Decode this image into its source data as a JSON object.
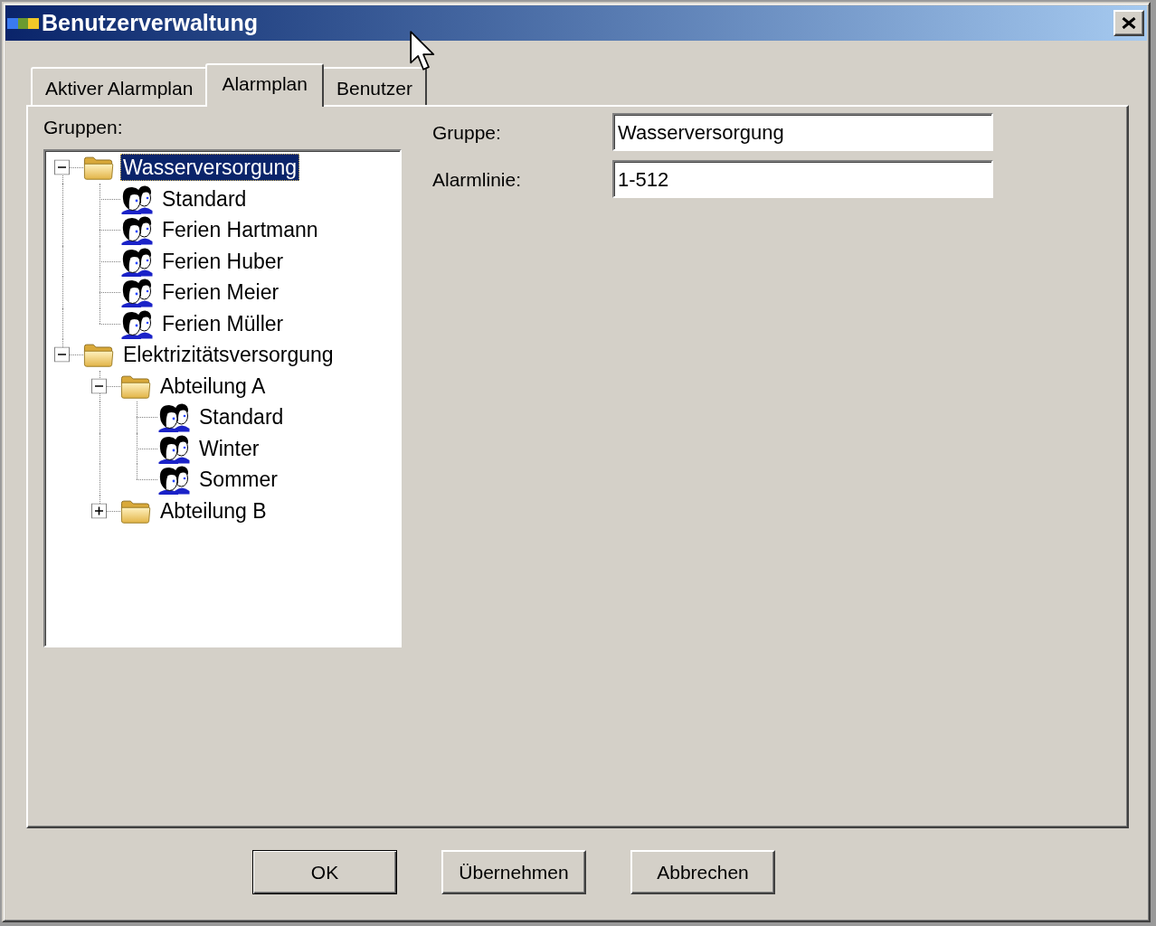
{
  "window": {
    "title": "Benutzerverwaltung"
  },
  "tabs": [
    {
      "label": "Aktiver Alarmplan",
      "selected": false
    },
    {
      "label": "Alarmplan",
      "selected": true
    },
    {
      "label": "Benutzer",
      "selected": false
    }
  ],
  "groups": {
    "label": "Gruppen:",
    "tree": [
      {
        "kind": "folder",
        "label": "Wasserversorgung",
        "expanded": true,
        "selected": true,
        "children": [
          {
            "kind": "user_group",
            "label": "Standard",
            "selected": false
          },
          {
            "kind": "user_group",
            "label": "Ferien Hartmann",
            "selected": false
          },
          {
            "kind": "user_group",
            "label": "Ferien Huber",
            "selected": false
          },
          {
            "kind": "user_group",
            "label": "Ferien Meier",
            "selected": false
          },
          {
            "kind": "user_group",
            "label": "Ferien Müller",
            "selected": false
          }
        ]
      },
      {
        "kind": "folder",
        "label": "Elektrizitätsversorgung",
        "expanded": true,
        "selected": false,
        "children": [
          {
            "kind": "folder",
            "label": "Abteilung A",
            "expanded": true,
            "selected": false,
            "children": [
              {
                "kind": "user_group",
                "label": "Standard",
                "selected": false
              },
              {
                "kind": "user_group",
                "label": "Winter",
                "selected": false
              },
              {
                "kind": "user_group",
                "label": "Sommer",
                "selected": false
              }
            ]
          },
          {
            "kind": "folder",
            "label": "Abteilung B",
            "expanded": false,
            "selected": false
          }
        ]
      }
    ]
  },
  "details": {
    "fields": [
      {
        "label": "Gruppe:",
        "value": "Wasserversorgung"
      },
      {
        "label": "Alarmlinie:",
        "value": "1-512"
      }
    ]
  },
  "buttons": [
    {
      "label": "OK",
      "default": true
    },
    {
      "label": "Übernehmen",
      "default": false
    },
    {
      "label": "Abbrechen",
      "default": false
    }
  ]
}
